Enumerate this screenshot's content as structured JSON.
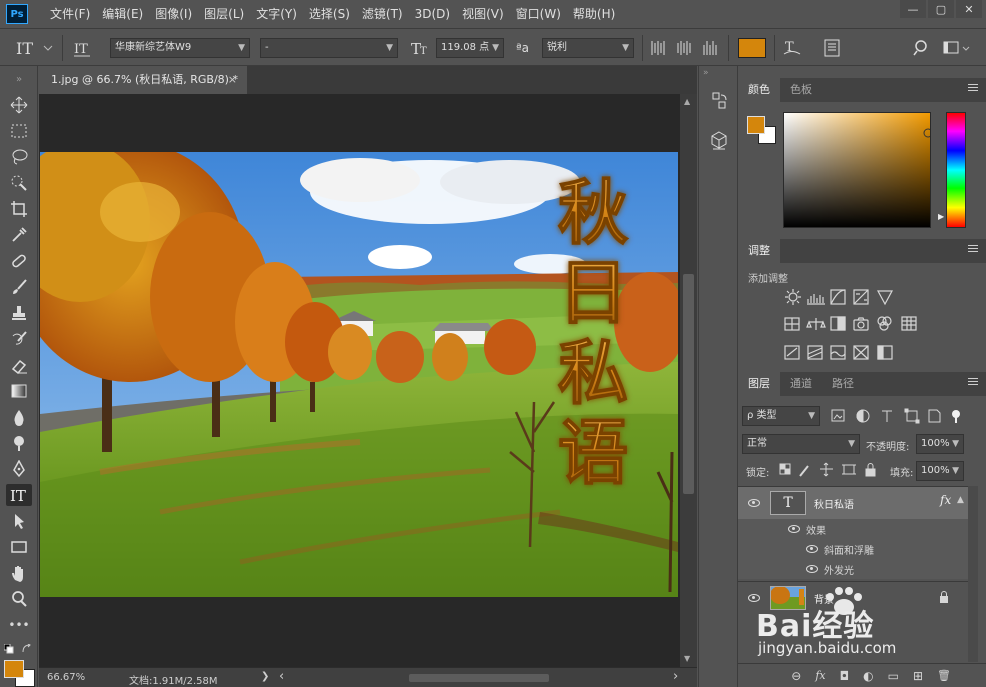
{
  "app": {
    "logo": "Ps"
  },
  "menu": [
    "文件(F)",
    "编辑(E)",
    "图像(I)",
    "图层(L)",
    "文字(Y)",
    "选择(S)",
    "滤镜(T)",
    "3D(D)",
    "视图(V)",
    "窗口(W)",
    "帮助(H)"
  ],
  "window_controls": {
    "minimize": "—",
    "restore": "▢",
    "close": "✕"
  },
  "options": {
    "font_family": "华康新综艺体W9",
    "font_style": "-",
    "font_size": "119.08 点",
    "aa_label": "ªa",
    "antialias": "锐利",
    "text_color": "#d4860c"
  },
  "document": {
    "tab_title": "1.jpg @ 66.7% (秋日私语, RGB/8) *",
    "close_glyph": "×",
    "text_chars": [
      "秋",
      "日",
      "私",
      "语"
    ],
    "zoom": "66.67%",
    "doc_info": "文档:1.91M/2.58M",
    "status_arrow": "❯",
    "scroll_left": "‹",
    "scroll_right": "›"
  },
  "colors": {
    "foreground": "#d4860c",
    "background": "#ffffff",
    "accent": "#31a8ff"
  },
  "color_panel": {
    "tabs": [
      "颜色",
      "色板"
    ]
  },
  "adjust_panel": {
    "tab": "调整",
    "add_label": "添加调整"
  },
  "layers_panel": {
    "tabs": [
      "图层",
      "通道",
      "路径"
    ],
    "kind_filter": "ρ 类型",
    "blend_mode": "正常",
    "opacity_label": "不透明度:",
    "opacity_value": "100%",
    "lock_label": "锁定:",
    "fill_label": "填充:",
    "fill_value": "100%",
    "layers": [
      {
        "name": "秋日私语",
        "thumb": "T",
        "fx": "fx"
      },
      {
        "name": "效果"
      },
      {
        "name": "斜面和浮雕"
      },
      {
        "name": "外发光"
      },
      {
        "name": "背景"
      }
    ],
    "footer": [
      "⊖",
      "fx",
      "◘",
      "◐",
      "▭",
      "⊞",
      "🗑"
    ]
  },
  "watermark": {
    "brand": "Bai经验",
    "url": "jingyan.baidu.com"
  }
}
